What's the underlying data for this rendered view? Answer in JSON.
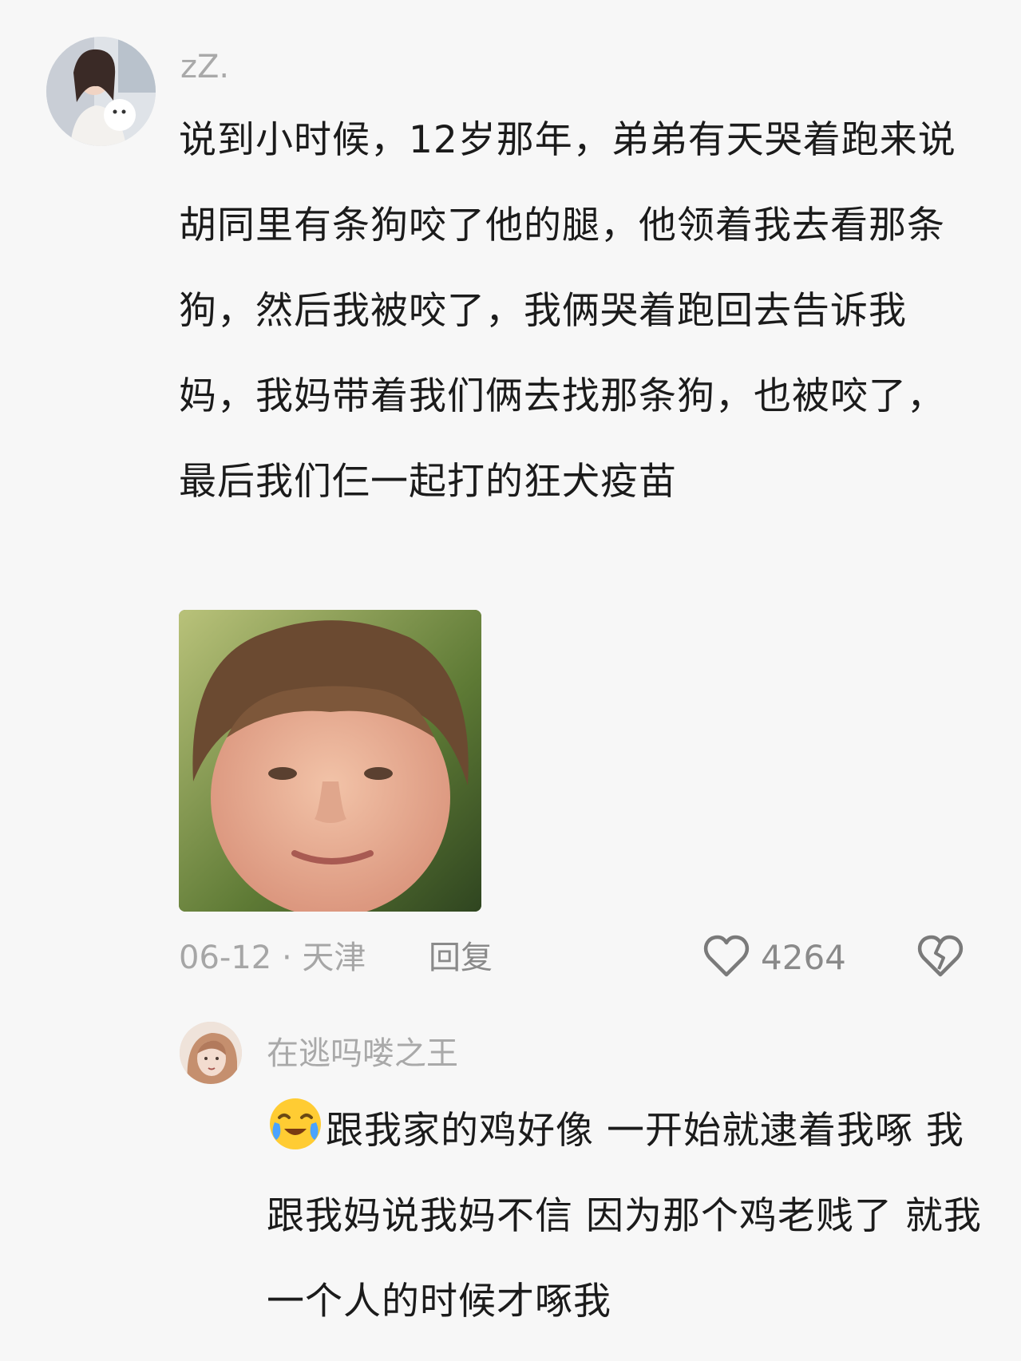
{
  "comment": {
    "username": "zZ.",
    "text": "说到小时候，12岁那年，弟弟有天哭着跑来说胡同里有条狗咬了他的腿，他领着我去看那条狗，然后我被咬了，我俩哭着跑回去告诉我妈，我妈带着我们俩去找那条狗，也被咬了，最后我们仨一起打的狂犬疫苗",
    "meta": "06-12 · 天津",
    "reply_label": "回复",
    "like_count": "4264",
    "icons": {
      "like": "heart-outline-icon",
      "dislike": "broken-heart-icon"
    }
  },
  "reply": {
    "username": "在逃吗喽之王",
    "emoji": "crying-laughing-emoji",
    "text": "跟我家的鸡好像 一开始就逮着我啄 我跟我妈说我妈不信 因为那个鸡老贱了 就我一个人的时候才啄我"
  },
  "colors": {
    "background": "#f7f7f7",
    "text": "#1b1b1b",
    "secondary_text": "#a9a9a9"
  }
}
